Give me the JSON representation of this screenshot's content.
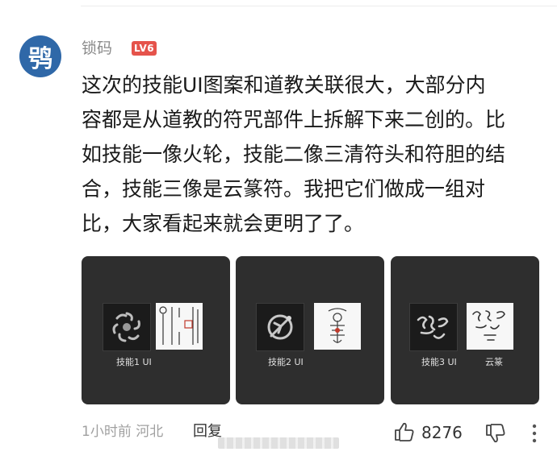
{
  "comment": {
    "avatar_char": "鸮",
    "username": "锁码",
    "level_badge": "LV6",
    "lines": [
      "这次的技能UI图案和道教关联很大，大部分内",
      "容都是从道教的符咒部件上拆解下来二创的。比",
      "如技能一像火轮，技能二像三清符头和符胆的结",
      "合，技能三像是云篆符。我把它们做成一组对",
      "比，大家看起来就会更明了了。"
    ],
    "images": [
      {
        "label_left": "技能1 UI",
        "label_right": ""
      },
      {
        "label_left": "技能2 UI",
        "label_right": ""
      },
      {
        "label_left": "技能3 UI",
        "label_right": "云篆"
      }
    ],
    "footer": {
      "time_location": "1小时前 河北",
      "reply_label": "回复",
      "like_count": "8276"
    }
  },
  "icons": {
    "like": "thumbs-up-icon",
    "dislike": "thumbs-down-icon",
    "more": "more-vertical-icon"
  },
  "colors": {
    "avatar_bg": "#2f68a8",
    "badge_bg": "#e5534b",
    "card_bg": "#2e2e2e"
  }
}
